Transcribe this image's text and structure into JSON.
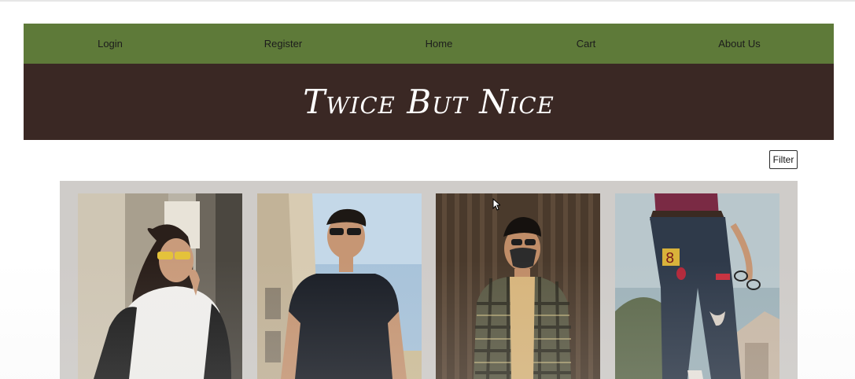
{
  "nav": {
    "items": [
      "Login",
      "Register",
      "Home",
      "Cart",
      "About Us"
    ],
    "color": "#5e7a39"
  },
  "banner": {
    "brand": "Twice But Nice",
    "color": "#3a2824"
  },
  "toolbar": {
    "filter_label": "Filter"
  },
  "gallery": {
    "background": "#cfccc9",
    "products": [
      {
        "icon": "woman-white-tshirt-yellow-sunglasses-photo"
      },
      {
        "icon": "man-black-tshirt-sunglasses-photo"
      },
      {
        "icon": "man-plaid-shirt-face-mask-photo"
      },
      {
        "icon": "patched-jeans-photo"
      }
    ]
  }
}
